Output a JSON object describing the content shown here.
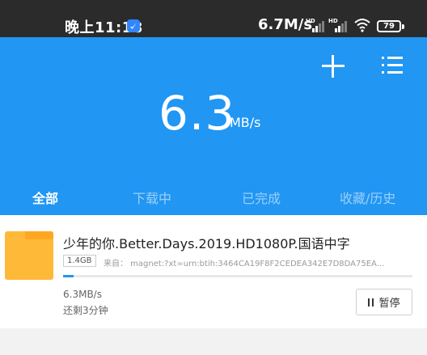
{
  "status_bar": {
    "time": "晚上11:18",
    "network_speed": "6.7M/s",
    "signal_label_1": "HD",
    "signal_label_2": "HD",
    "battery": "79"
  },
  "header": {
    "speed_value": "6.3",
    "speed_unit": "MB/s",
    "icons": [
      "plus-icon",
      "list-icon"
    ]
  },
  "tabs": [
    {
      "label": "全部",
      "active": true
    },
    {
      "label": "下载中",
      "active": false
    },
    {
      "label": "已完成",
      "active": false
    },
    {
      "label": "收藏/历史",
      "active": false
    }
  ],
  "task": {
    "title": "少年的你.Better.Days.2019.HD1080P.国语中字",
    "size": "1.4GB",
    "source": "来自： magnet:?xt=urn:btih:3464CA19F8F2CEDEA342E7D8DA75EA...",
    "progress": 0.03,
    "speed": "6.3MB/s",
    "remaining": "还剩3分钟",
    "pause_label": "暂停"
  },
  "colors": {
    "accent": "#2196f3",
    "status_bar_bg": "#2b2b2b",
    "folder": "#ffb938"
  }
}
